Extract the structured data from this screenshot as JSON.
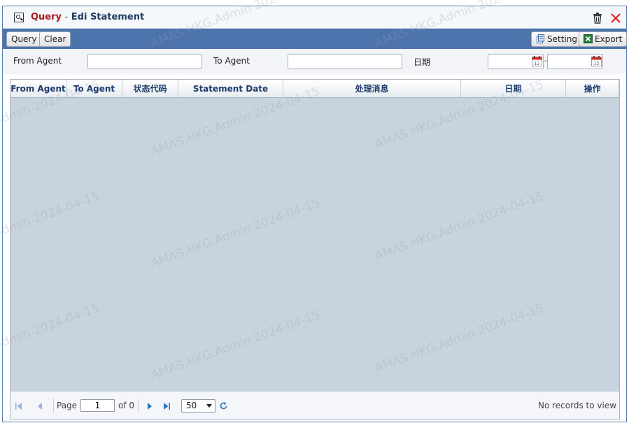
{
  "window": {
    "title_prefix": "Query",
    "title_separator": "-",
    "title_main": "Edi Statement"
  },
  "toolbar": {
    "query_label": "Query",
    "clear_label": "Clear",
    "setting_label": "Setting",
    "export_label": "Export"
  },
  "filters": {
    "from_agent_label": "From Agent",
    "from_agent_value": "",
    "to_agent_label": "To Agent",
    "to_agent_value": "",
    "date_label": "日期",
    "date_from_value": "",
    "date_to_value": "",
    "date_separator": "-"
  },
  "grid": {
    "columns": [
      "From Agent",
      "To Agent",
      "状态代码",
      "Statement Date",
      "处理消息",
      "日期",
      "操作"
    ],
    "rows": []
  },
  "pager": {
    "page_label": "Page",
    "page_value": "1",
    "of_label": "of 0",
    "page_size": "50",
    "status": "No records to view"
  },
  "watermark": {
    "text": "AMAS.HKG.Admin 2024-04-15"
  },
  "colors": {
    "toolbar_bg": "#4c73ac",
    "title_accent": "#a31d1d",
    "grid_body": "#c9d3dd",
    "header_text": "#1d3c6e"
  }
}
